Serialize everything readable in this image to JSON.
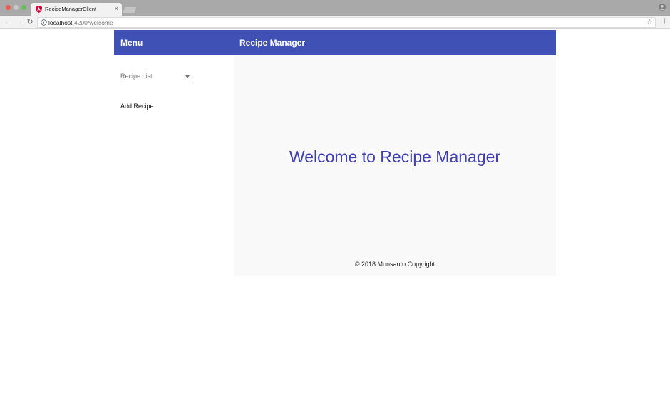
{
  "browser": {
    "tab_title": "RecipeManagerClient",
    "tab_close": "×",
    "url_host": "localhost",
    "url_rest": ":4200/welcome",
    "star": "☆",
    "menu": "⋮",
    "back": "←",
    "forward": "→",
    "reload": "↻"
  },
  "header": {
    "menu_title": "Menu",
    "app_title": "Recipe Manager",
    "color": "#3f51b5"
  },
  "sidenav": {
    "recipe_list_label": "Recipe List",
    "add_recipe_label": "Add Recipe"
  },
  "main": {
    "welcome_text": "Welcome to Recipe Manager",
    "welcome_color": "#3f3fb5",
    "copyright": "© 2018 Monsanto Copyright"
  }
}
